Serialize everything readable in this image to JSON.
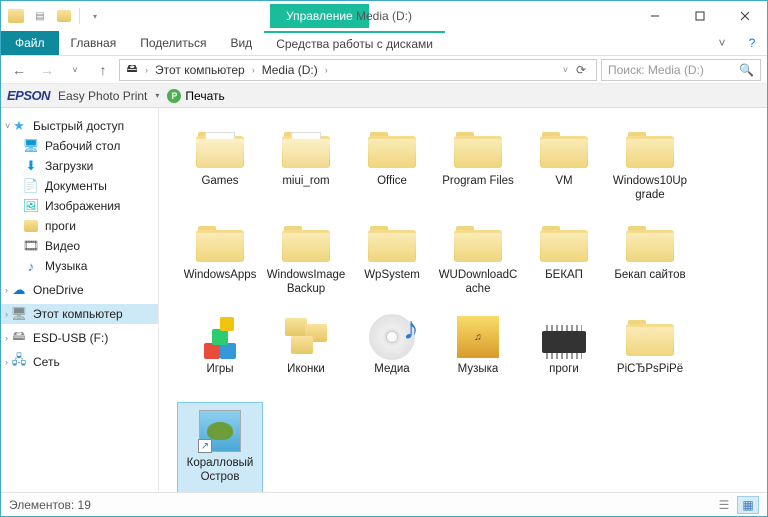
{
  "title": "Media (D:)",
  "ribbon": {
    "file": "Файл",
    "home": "Главная",
    "share": "Поделиться",
    "view": "Вид",
    "drivetools": "Средства работы с дисками",
    "context": "Управление"
  },
  "breadcrumb": {
    "root": "Этот компьютер",
    "current": "Media (D:)"
  },
  "search": {
    "placeholder": "Поиск: Media (D:)"
  },
  "epson": {
    "brand": "EPSON",
    "product": "Easy Photo Print",
    "print": "Печать"
  },
  "sidebar": {
    "quick": "Быстрый доступ",
    "desktop": "Рабочий стол",
    "downloads": "Загрузки",
    "documents": "Документы",
    "pictures": "Изображения",
    "progi": "проги",
    "videos": "Видео",
    "music": "Музыка",
    "onedrive": "OneDrive",
    "thispc": "Этот компьютер",
    "esd": "ESD-USB (F:)",
    "network": "Сеть"
  },
  "items": [
    {
      "label": "Games",
      "type": "folder-open"
    },
    {
      "label": "miui_rom",
      "type": "folder-open"
    },
    {
      "label": "Office",
      "type": "folder"
    },
    {
      "label": "Program Files",
      "type": "folder"
    },
    {
      "label": "VM",
      "type": "folder"
    },
    {
      "label": "Windows10Upgrade",
      "type": "folder"
    },
    {
      "label": "WindowsApps",
      "type": "folder"
    },
    {
      "label": "WindowsImageBackup",
      "type": "folder"
    },
    {
      "label": "WpSystem",
      "type": "folder"
    },
    {
      "label": "WUDownloadCache",
      "type": "folder"
    },
    {
      "label": "БЕКАП",
      "type": "folder"
    },
    {
      "label": "Бекап сайтов",
      "type": "folder"
    },
    {
      "label": "Игры",
      "type": "blocks"
    },
    {
      "label": "Иконки",
      "type": "mini-folders"
    },
    {
      "label": "Медиа",
      "type": "disc"
    },
    {
      "label": "Музыка",
      "type": "music"
    },
    {
      "label": "проги",
      "type": "chip"
    },
    {
      "label": "РіСЂРѕРіРё",
      "type": "folder"
    },
    {
      "label": "Коралловый Остров",
      "type": "shortcut",
      "selected": true
    }
  ],
  "status": {
    "label": "Элементов:",
    "count": "19"
  }
}
